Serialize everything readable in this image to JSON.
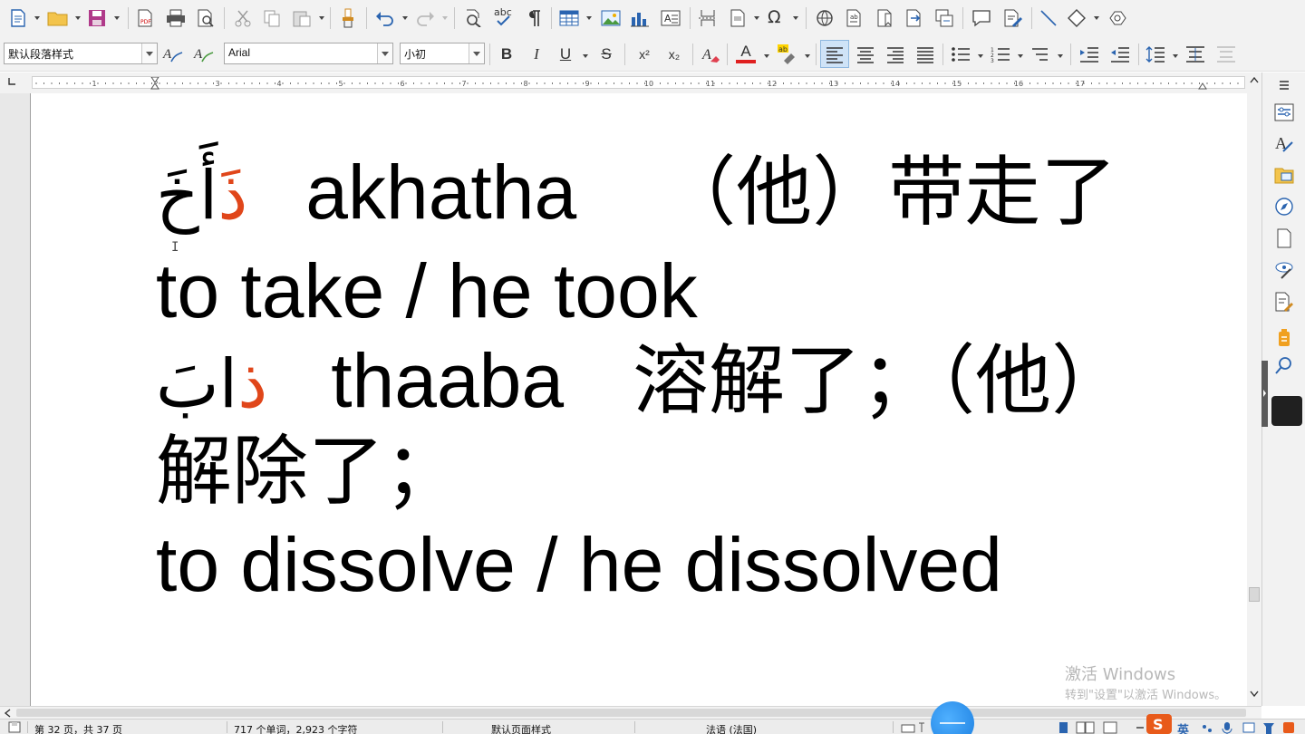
{
  "toolbar": {
    "paragraph_style": "默认段落样式",
    "font_name": "Arial",
    "font_size": "小初",
    "bold": "B",
    "italic": "I",
    "underline": "U",
    "strikethrough": "S",
    "superscript": "x²",
    "subscript": "x₂",
    "font_color_letter": "A",
    "font_color": "#e02020",
    "highlight_color": "#ffd400",
    "accent": "#1f6fbf"
  },
  "ruler": {
    "numbers": [
      "1",
      "2",
      "3",
      "4",
      "5",
      "6",
      "7",
      "8",
      "9",
      "10",
      "11",
      "12",
      "13",
      "14",
      "15",
      "16",
      "17"
    ]
  },
  "document": {
    "line1": {
      "arabic_orange": "ذَ",
      "arabic_black": "أَخَ",
      "transliteration": "akhatha",
      "chinese": "（他）带走了"
    },
    "line2": "to take / he took",
    "line3": {
      "arabic_black": "ابَ",
      "arabic_orange": "ذ",
      "transliteration": "thaaba",
      "chinese": "溶解了；（他）"
    },
    "line4": "解除了；",
    "line5": "to dissolve / he dissolved",
    "highlight_color": "#e0461a"
  },
  "status_bar": {
    "page_info": "第 32 页，共 37 页",
    "word_count": "717 个单词，2,923 个字符",
    "page_style": "默认页面样式",
    "language": "法语 (法国)",
    "ime_lang": "英"
  },
  "watermark": {
    "line1": "激活 Windows",
    "line2": "转到\"设置\"以激活 Windows。"
  },
  "icons": [
    "new-document-icon",
    "open-folder-icon",
    "save-icon",
    "export-pdf-icon",
    "print-icon",
    "print-preview-icon",
    "cut-icon",
    "copy-icon",
    "paste-icon",
    "clone-format-icon",
    "undo-icon",
    "redo-icon",
    "find-replace-icon",
    "spellcheck-icon",
    "formatting-marks-icon",
    "table-icon",
    "image-icon",
    "chart-icon",
    "textbox-icon",
    "page-break-icon",
    "field-icon",
    "special-char-icon",
    "hyperlink-icon",
    "footnote-icon",
    "bookmark-icon",
    "cross-ref-icon",
    "comment-icon",
    "track-changes-icon",
    "line-icon",
    "shapes-icon",
    "draw-icon"
  ]
}
